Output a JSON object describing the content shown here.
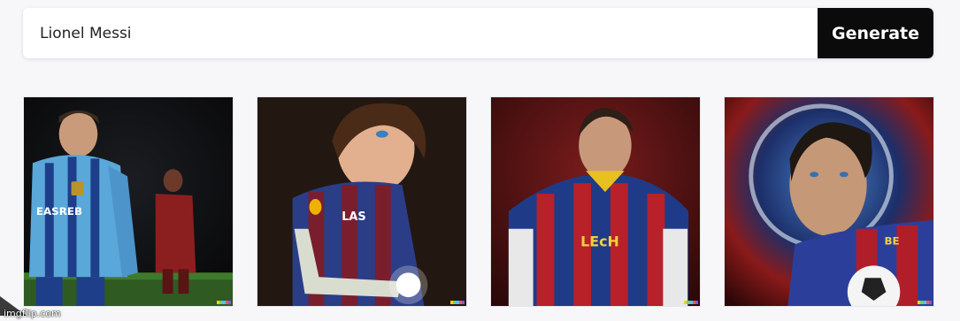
{
  "search": {
    "value": "Lionel Messi",
    "placeholder": ""
  },
  "generate_label": "Generate",
  "images": [
    {
      "subject": "soccer player in light blue striped kit",
      "jersey_text": "EASREB"
    },
    {
      "subject": "cartoon soccer player in blue and maroon kit",
      "jersey_text": "LAS"
    },
    {
      "subject": "soccer player in blue and red striped kit",
      "jersey_text": "LEcH"
    },
    {
      "subject": "soccer player close-up with ball",
      "jersey_text": ""
    }
  ],
  "colors": {
    "watermark": [
      "#f5d400",
      "#6bd26b",
      "#53c2e8",
      "#e85a5a",
      "#8a55d9"
    ]
  },
  "watermark_text": "imgflip.com"
}
